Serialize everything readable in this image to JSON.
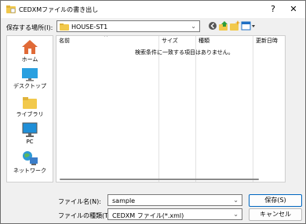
{
  "window": {
    "title": "CEDXMファイルの書き出し",
    "help_glyph": "?",
    "close_glyph": "✕"
  },
  "location": {
    "label": "保存する場所(I):",
    "value": "HOUSE-ST1"
  },
  "places": [
    {
      "label": "ホーム",
      "icon": "home-icon"
    },
    {
      "label": "デスクトップ",
      "icon": "desktop-icon"
    },
    {
      "label": "ライブラリ",
      "icon": "library-icon"
    },
    {
      "label": "PC",
      "icon": "pc-icon"
    },
    {
      "label": "ネットワーク",
      "icon": "network-icon"
    }
  ],
  "list": {
    "columns": [
      "名前",
      "サイズ",
      "種類",
      "更新日時"
    ],
    "empty_message": "検索条件に一致する項目はありません。"
  },
  "filename": {
    "label": "ファイル名(N):",
    "value": "sample"
  },
  "filetype": {
    "label": "ファイルの種類(T):",
    "value": "CEDXM ファイル(*.xml)"
  },
  "buttons": {
    "save": "保存(S)",
    "cancel": "キャンセル"
  },
  "colors": {
    "accent": "#0067c0",
    "folder": "#f2c94c"
  }
}
